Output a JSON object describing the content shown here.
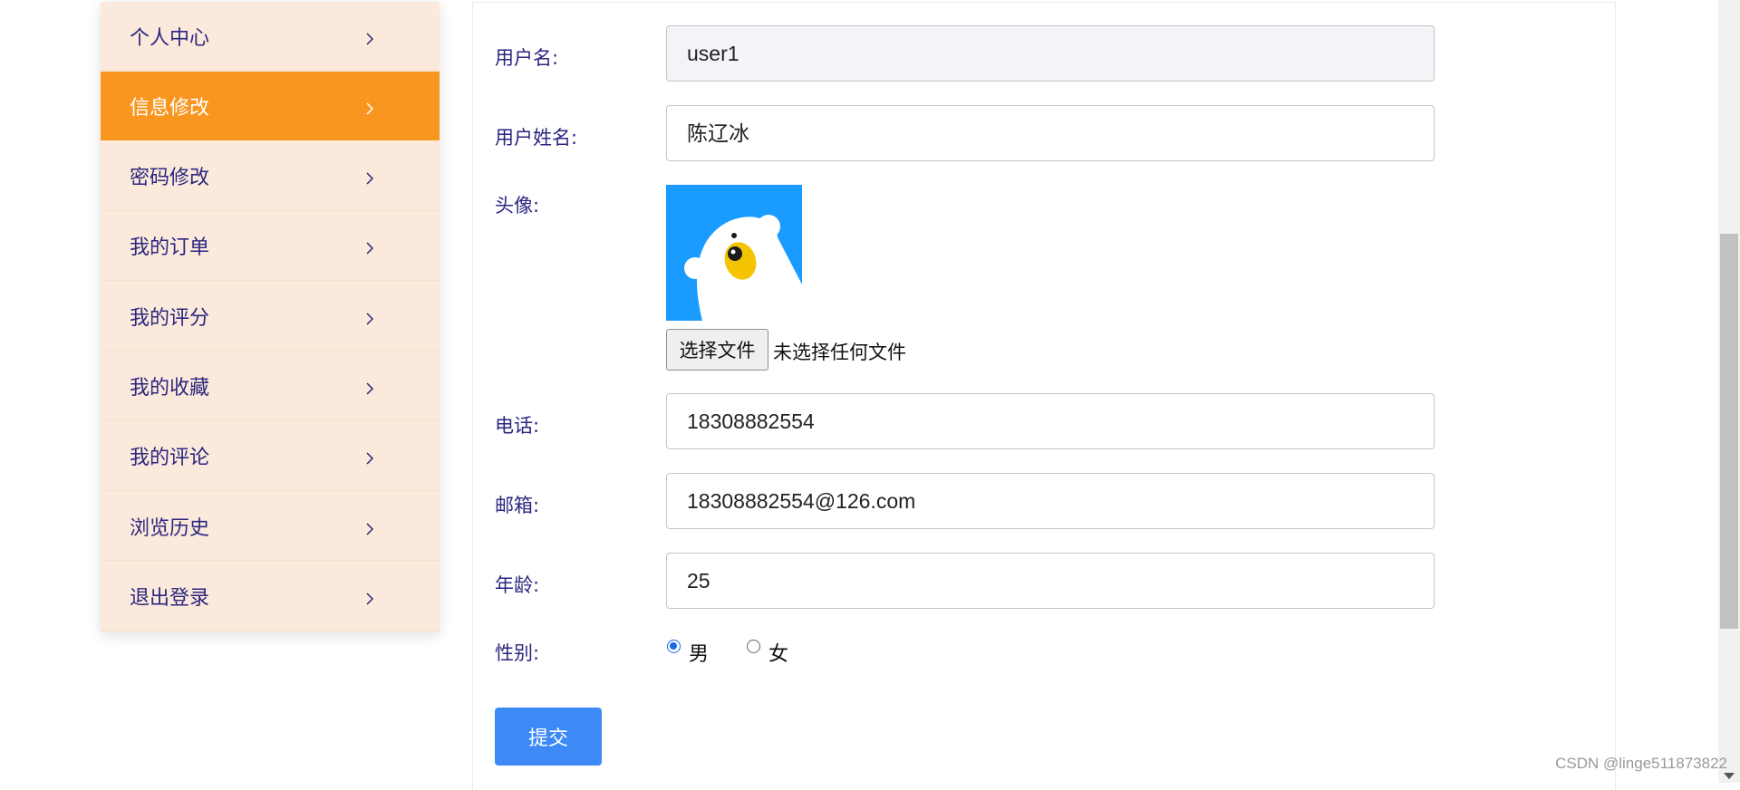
{
  "sidebar": {
    "items": [
      {
        "label": "个人中心"
      },
      {
        "label": "信息修改",
        "active": true
      },
      {
        "label": "密码修改"
      },
      {
        "label": "我的订单"
      },
      {
        "label": "我的评分"
      },
      {
        "label": "我的收藏"
      },
      {
        "label": "我的评论"
      },
      {
        "label": "浏览历史"
      },
      {
        "label": "退出登录"
      }
    ]
  },
  "form": {
    "username_label": "用户名:",
    "username_value": "user1",
    "realname_label": "用户姓名:",
    "realname_value": "陈辽冰",
    "avatar_label": "头像:",
    "file_button": "选择文件",
    "file_status": "未选择任何文件",
    "phone_label": "电话:",
    "phone_value": "18308882554",
    "email_label": "邮箱:",
    "email_value": "18308882554@126.com",
    "age_label": "年龄:",
    "age_value": "25",
    "gender_label": "性别:",
    "gender_options": [
      {
        "label": "男",
        "checked": true
      },
      {
        "label": "女",
        "checked": false
      }
    ],
    "submit_label": "提交"
  },
  "watermark": "CSDN @linge511873822",
  "colors": {
    "sidebar_bg": "#fbeadb",
    "active_bg": "#f9961f",
    "submit_bg": "#3d8af7",
    "avatar_bg": "#1a9bff"
  },
  "icons": {
    "chevron": "chevron-right-icon",
    "avatar": "polar-bear-avatar"
  }
}
